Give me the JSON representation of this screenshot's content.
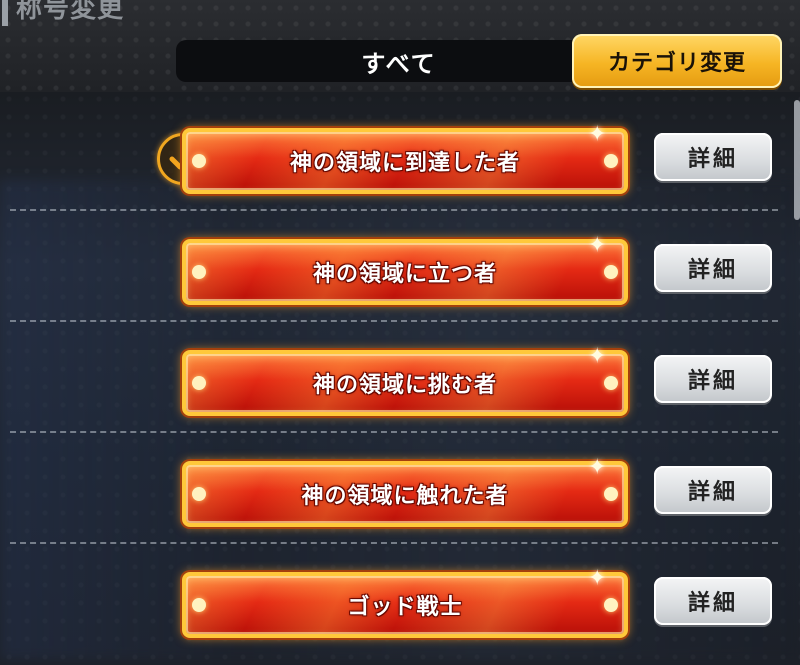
{
  "header": {
    "title": "称号変更"
  },
  "tabs": {
    "active_label": "すべて",
    "category_button_label": "カテゴリ変更"
  },
  "colors": {
    "accent_gold": "#f6b524",
    "plate_red": "#e52a14"
  },
  "titles": [
    {
      "name": "神の領域に到達した者",
      "equipped": true,
      "detail_label": "詳細"
    },
    {
      "name": "神の領域に立つ者",
      "equipped": false,
      "detail_label": "詳細"
    },
    {
      "name": "神の領域に挑む者",
      "equipped": false,
      "detail_label": "詳細"
    },
    {
      "name": "神の領域に触れた者",
      "equipped": false,
      "detail_label": "詳細"
    },
    {
      "name": "ゴッド戦士",
      "equipped": false,
      "detail_label": "詳細"
    }
  ],
  "icons": {
    "equipped": "check-icon",
    "sparkle": "sparkle-icon"
  }
}
